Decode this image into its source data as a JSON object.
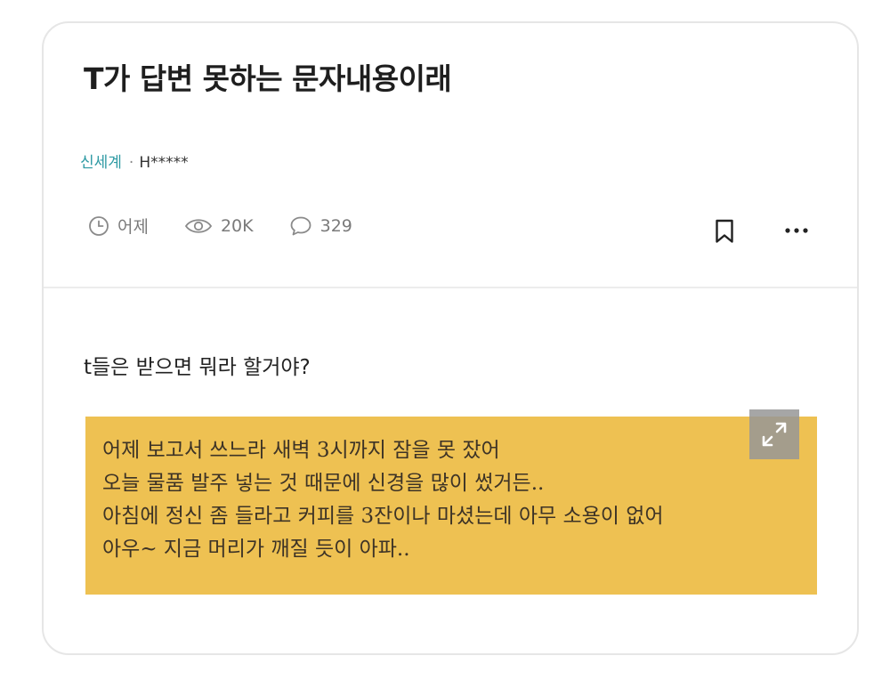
{
  "post": {
    "title": "T가 답변 못하는 문자내용이래",
    "board": "신세계",
    "separator": "·",
    "author": "H*****",
    "time": "어제",
    "views": "20K",
    "comments": "329"
  },
  "content": {
    "question": "t들은 받으면 뭐라 할거야?",
    "note_lines": [
      "어제 보고서 쓰느라 새벽 3시까지 잠을 못 잤어",
      "오늘 물품 발주 넣는 것 때문에 신경을 많이 썼거든..",
      "아침에 정신 좀 들라고 커피를 3잔이나 마셨는데 아무 소용이 없어",
      "아우~ 지금 머리가 깨질 듯이 아파.."
    ]
  },
  "colors": {
    "note_background": "#eec152",
    "board_link": "#2e9aa3"
  },
  "icons": [
    "clock-icon",
    "eye-icon",
    "comment-icon",
    "bookmark-icon",
    "more-icon",
    "expand-icon"
  ]
}
